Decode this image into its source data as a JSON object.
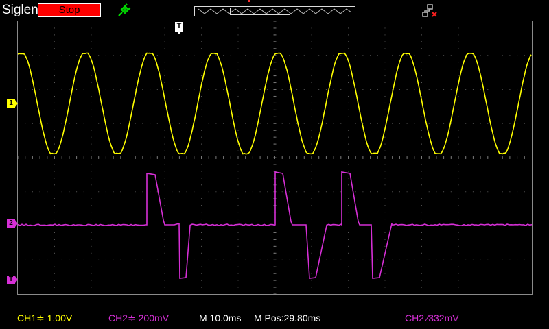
{
  "header": {
    "brand": "Siglent",
    "run_state": "Stop"
  },
  "icons": {
    "probe": "probe-icon",
    "network": "network-disconnected-icon"
  },
  "channels": {
    "ch1_marker": "1",
    "ch2_marker": "2",
    "trigger_level_marker": "T",
    "trigger_pos_marker": "T"
  },
  "colors": {
    "ch1": "#ffff00",
    "ch2": "#d62fd6",
    "run_stop": "#ff0000",
    "grid": "#5a5a5a"
  },
  "status_bar": {
    "ch1": "CH1≑ 1.00V",
    "ch2": "CH2≑ 200mV",
    "timebase": "M 10.0ms",
    "mpos": "M Pos:29.80ms",
    "trigger": "CH2 ∕332mV"
  }
}
